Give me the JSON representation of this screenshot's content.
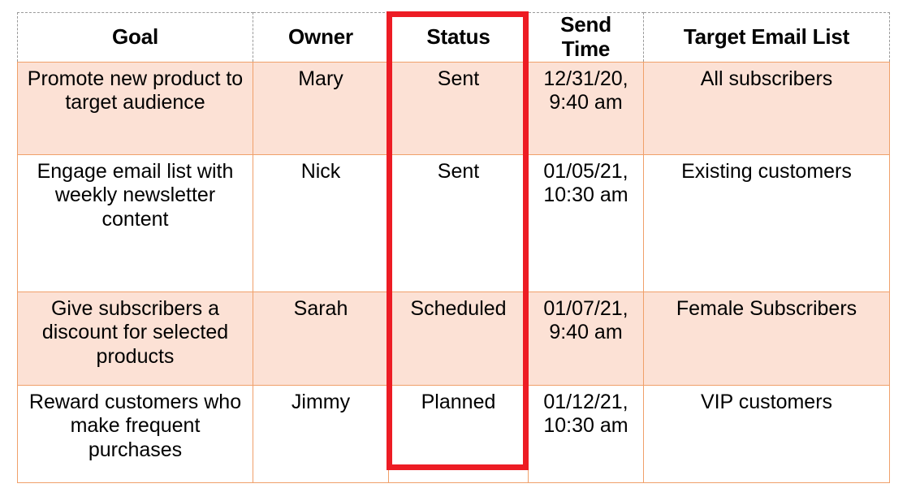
{
  "table": {
    "caption": "",
    "columns": [
      {
        "key": "goal",
        "label": "Goal"
      },
      {
        "key": "owner",
        "label": "Owner"
      },
      {
        "key": "status",
        "label": "Status"
      },
      {
        "key": "send",
        "label": "Send Time"
      },
      {
        "key": "target",
        "label": "Target Email List"
      }
    ],
    "rows": [
      {
        "goal": "Promote new product to target audience",
        "owner": "Mary",
        "status": "Sent",
        "send": "12/31/20, 9:40 am",
        "target": "All subscribers",
        "shaded": true
      },
      {
        "goal": "Engage email list with weekly newsletter content",
        "owner": "Nick",
        "status": "Sent",
        "send": "01/05/21, 10:30 am",
        "target": "Existing customers",
        "shaded": false
      },
      {
        "goal": "Give subscribers a discount for selected products",
        "owner": "Sarah",
        "status": "Scheduled",
        "send": "01/07/21, 9:40 am",
        "target": "Female Subscribers",
        "shaded": true
      },
      {
        "goal": "Reward customers who make frequent purchases",
        "owner": "Jimmy",
        "status": "Planned",
        "send": "01/12/21, 10:30 am",
        "target": "VIP customers",
        "shaded": false
      }
    ]
  },
  "highlight": {
    "target_column": "Status",
    "color": "#ED1C24"
  },
  "colors": {
    "shaded_row_fill": "#FCE1D5",
    "plain_row_fill": "#FFFFFF",
    "body_border": "#F0A06A",
    "header_border": "#9A9A9A",
    "highlight_outline": "#ED1C24",
    "text": "#000000"
  }
}
